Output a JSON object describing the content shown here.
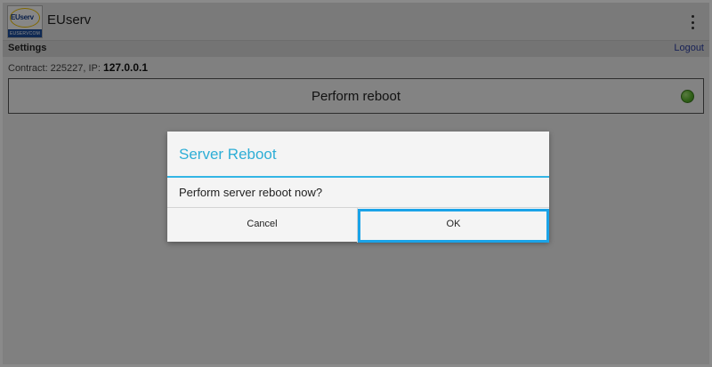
{
  "app": {
    "title": "EUserv",
    "logo_text": "EUserv",
    "logo_band_text": "EUSERVCOM"
  },
  "settings_bar": {
    "title": "Settings",
    "logout_label": "Logout"
  },
  "contract": {
    "prefix": "Contract: 225227, IP: ",
    "ip": "127.0.0.1"
  },
  "reboot_button": {
    "label": "Perform reboot",
    "status": "online",
    "status_color": "#5cb82e"
  },
  "dialog": {
    "title": "Server Reboot",
    "message": "Perform server reboot now?",
    "cancel_label": "Cancel",
    "ok_label": "OK",
    "accent_color": "#33b5e5"
  }
}
